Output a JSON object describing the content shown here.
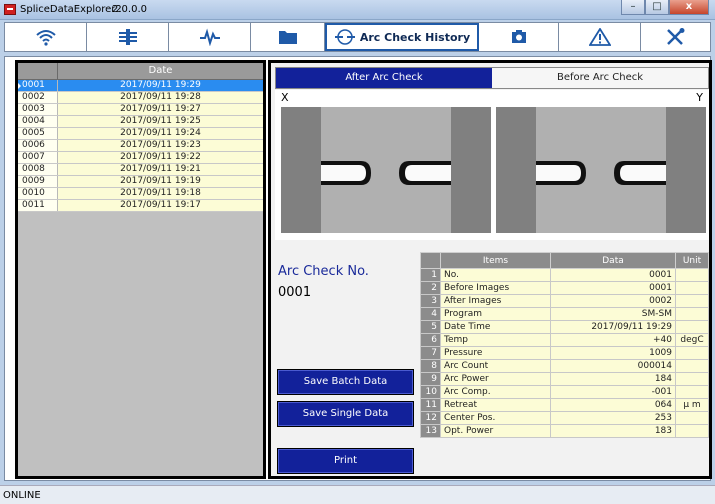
{
  "window": {
    "title": "SpliceDataExplorer2",
    "version": "2.0.0.0",
    "buttons": {
      "minimize": "–",
      "maximize": "□",
      "close": "x"
    }
  },
  "toolbar": {
    "items": [
      {
        "icon": "wifi-icon",
        "label": ""
      },
      {
        "icon": "splice-icon",
        "label": ""
      },
      {
        "icon": "heartbeat-icon",
        "label": ""
      },
      {
        "icon": "folder-icon",
        "label": ""
      },
      {
        "icon": "arc-check-icon",
        "label": "Arc Check History"
      },
      {
        "icon": "camera-icon",
        "label": ""
      },
      {
        "icon": "warning-icon",
        "label": ""
      },
      {
        "icon": "tools-icon",
        "label": ""
      }
    ]
  },
  "list": {
    "header": "Date",
    "rows": [
      {
        "no": "0001",
        "date": "2017/09/11 19:29",
        "selected": true
      },
      {
        "no": "0002",
        "date": "2017/09/11 19:28"
      },
      {
        "no": "0003",
        "date": "2017/09/11 19:27"
      },
      {
        "no": "0004",
        "date": "2017/09/11 19:25"
      },
      {
        "no": "0005",
        "date": "2017/09/11 19:24"
      },
      {
        "no": "0006",
        "date": "2017/09/11 19:23"
      },
      {
        "no": "0007",
        "date": "2017/09/11 19:22"
      },
      {
        "no": "0008",
        "date": "2017/09/11 19:21"
      },
      {
        "no": "0009",
        "date": "2017/09/11 19:19"
      },
      {
        "no": "0010",
        "date": "2017/09/11 19:18"
      },
      {
        "no": "0011",
        "date": "2017/09/11 19:17"
      }
    ]
  },
  "tabs": {
    "after": "After Arc Check",
    "before": "Before Arc Check"
  },
  "images": {
    "x_label": "X",
    "y_label": "Y"
  },
  "detail": {
    "arc_no_label": "Arc Check No.",
    "arc_no_value": "0001",
    "buttons": {
      "save_batch": "Save Batch Data",
      "save_single": "Save Single Data",
      "print": "Print"
    }
  },
  "table": {
    "headers": {
      "items": "Items",
      "data": "Data",
      "unit": "Unit"
    },
    "rows": [
      {
        "n": "1",
        "item": "No.",
        "data": "0001",
        "unit": ""
      },
      {
        "n": "2",
        "item": "Before Images",
        "data": "0001",
        "unit": ""
      },
      {
        "n": "3",
        "item": "After Images",
        "data": "0002",
        "unit": ""
      },
      {
        "n": "4",
        "item": "Program",
        "data": "SM-SM",
        "unit": ""
      },
      {
        "n": "5",
        "item": "Date Time",
        "data": "2017/09/11 19:29",
        "unit": ""
      },
      {
        "n": "6",
        "item": "Temp",
        "data": "+40",
        "unit": "degC"
      },
      {
        "n": "7",
        "item": "Pressure",
        "data": "1009",
        "unit": ""
      },
      {
        "n": "8",
        "item": "Arc Count",
        "data": "000014",
        "unit": ""
      },
      {
        "n": "9",
        "item": "Arc Power",
        "data": "184",
        "unit": ""
      },
      {
        "n": "10",
        "item": "Arc Comp.",
        "data": "-001",
        "unit": ""
      },
      {
        "n": "11",
        "item": "Retreat",
        "data": "064",
        "unit": "μ m"
      },
      {
        "n": "12",
        "item": "Center Pos.",
        "data": "253",
        "unit": ""
      },
      {
        "n": "13",
        "item": "Opt. Power",
        "data": "183",
        "unit": ""
      }
    ]
  },
  "status": {
    "text": "ONLINE"
  },
  "colors": {
    "accent": "#12219a",
    "selection": "#2a8cf0",
    "row_bg": "#fcfcd6"
  }
}
